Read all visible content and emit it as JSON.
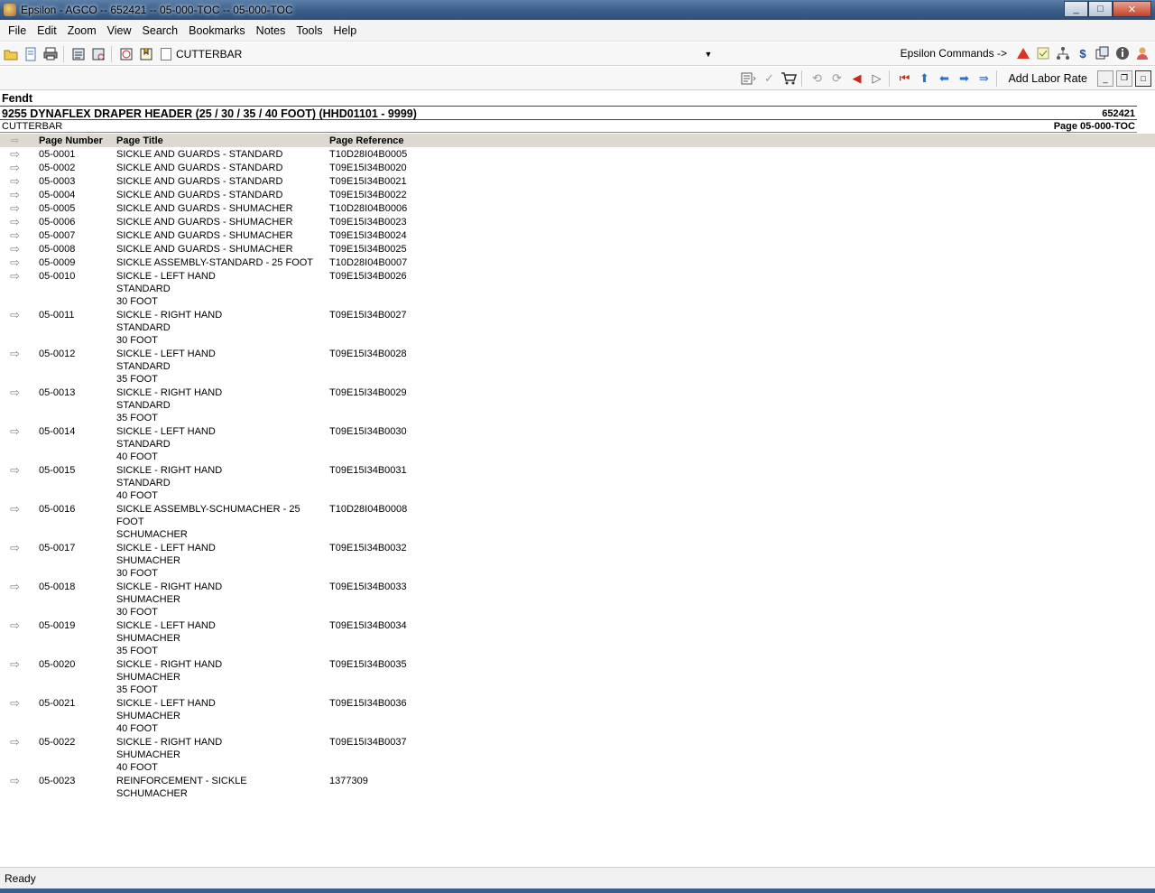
{
  "window": {
    "title": "Epsilon - AGCO -- 652421 -- 05-000-TOC -- 05-000-TOC",
    "minimize": "_",
    "maximize": "□",
    "close": "✕"
  },
  "menu": [
    {
      "label": "File"
    },
    {
      "label": "Edit"
    },
    {
      "label": "Zoom"
    },
    {
      "label": "View"
    },
    {
      "label": "Search"
    },
    {
      "label": "Bookmarks"
    },
    {
      "label": "Notes"
    },
    {
      "label": "Tools"
    },
    {
      "label": "Help"
    }
  ],
  "toolbar": {
    "path": "CUTTERBAR",
    "epsilon_commands": "Epsilon Commands ->",
    "add_labor_rate": "Add Labor Rate"
  },
  "document": {
    "make": "Fendt",
    "model": "9255 DYNAFLEX DRAPER HEADER (25 / 30 / 35 / 40 FOOT) (HHD01101 - 9999)",
    "model_code": "652421",
    "section": "CUTTERBAR",
    "page_label": "Page 05-000-TOC",
    "columns": {
      "page_number": "Page Number",
      "page_title": "Page Title",
      "page_reference": "Page Reference"
    },
    "rows": [
      {
        "num": "05-0001",
        "title": [
          "SICKLE AND GUARDS - STANDARD"
        ],
        "ref": "T10D28I04B0005"
      },
      {
        "num": "05-0002",
        "title": [
          "SICKLE AND GUARDS - STANDARD"
        ],
        "ref": "T09E15I34B0020"
      },
      {
        "num": "05-0003",
        "title": [
          "SICKLE AND GUARDS - STANDARD"
        ],
        "ref": "T09E15I34B0021"
      },
      {
        "num": "05-0004",
        "title": [
          "SICKLE AND GUARDS - STANDARD"
        ],
        "ref": "T09E15I34B0022"
      },
      {
        "num": "05-0005",
        "title": [
          "SICKLE AND GUARDS - SHUMACHER"
        ],
        "ref": "T10D28I04B0006"
      },
      {
        "num": "05-0006",
        "title": [
          "SICKLE AND GUARDS - SHUMACHER"
        ],
        "ref": "T09E15I34B0023"
      },
      {
        "num": "05-0007",
        "title": [
          "SICKLE AND GUARDS - SHUMACHER"
        ],
        "ref": "T09E15I34B0024"
      },
      {
        "num": "05-0008",
        "title": [
          "SICKLE AND GUARDS - SHUMACHER"
        ],
        "ref": "T09E15I34B0025"
      },
      {
        "num": "05-0009",
        "title": [
          "SICKLE ASSEMBLY-STANDARD  - 25 FOOT"
        ],
        "ref": "T10D28I04B0007"
      },
      {
        "num": "05-0010",
        "title": [
          "SICKLE - LEFT HAND",
          "STANDARD",
          "30 FOOT"
        ],
        "ref": "T09E15I34B0026"
      },
      {
        "num": "05-0011",
        "title": [
          "SICKLE - RIGHT HAND",
          "STANDARD",
          "30 FOOT"
        ],
        "ref": "T09E15I34B0027"
      },
      {
        "num": "05-0012",
        "title": [
          "SICKLE - LEFT HAND",
          "STANDARD",
          "35 FOOT"
        ],
        "ref": "T09E15I34B0028"
      },
      {
        "num": "05-0013",
        "title": [
          "SICKLE - RIGHT HAND",
          "STANDARD",
          "35 FOOT"
        ],
        "ref": "T09E15I34B0029"
      },
      {
        "num": "05-0014",
        "title": [
          "SICKLE - LEFT HAND",
          "STANDARD",
          "40 FOOT"
        ],
        "ref": "T09E15I34B0030"
      },
      {
        "num": "05-0015",
        "title": [
          "SICKLE - RIGHT HAND",
          "STANDARD",
          "40 FOOT"
        ],
        "ref": "T09E15I34B0031"
      },
      {
        "num": "05-0016",
        "title": [
          "SICKLE ASSEMBLY-SCHUMACHER  - 25 FOOT",
          "SCHUMACHER"
        ],
        "ref": "T10D28I04B0008"
      },
      {
        "num": "05-0017",
        "title": [
          "SICKLE - LEFT HAND",
          "SHUMACHER",
          "30 FOOT"
        ],
        "ref": "T09E15I34B0032"
      },
      {
        "num": "05-0018",
        "title": [
          "SICKLE - RIGHT HAND",
          "SHUMACHER",
          "30 FOOT"
        ],
        "ref": "T09E15I34B0033"
      },
      {
        "num": "05-0019",
        "title": [
          "SICKLE - LEFT HAND",
          "SHUMACHER",
          "35 FOOT"
        ],
        "ref": "T09E15I34B0034"
      },
      {
        "num": "05-0020",
        "title": [
          "SICKLE - RIGHT HAND",
          "SHUMACHER",
          "35 FOOT"
        ],
        "ref": "T09E15I34B0035"
      },
      {
        "num": "05-0021",
        "title": [
          "SICKLE - LEFT HAND",
          "SHUMACHER",
          "40 FOOT"
        ],
        "ref": "T09E15I34B0036"
      },
      {
        "num": "05-0022",
        "title": [
          "SICKLE - RIGHT HAND",
          "SHUMACHER",
          "40 FOOT"
        ],
        "ref": "T09E15I34B0037"
      },
      {
        "num": "05-0023",
        "title": [
          "REINFORCEMENT - SICKLE",
          "SCHUMACHER"
        ],
        "ref": "1377309"
      }
    ]
  },
  "status": {
    "text": "Ready"
  }
}
